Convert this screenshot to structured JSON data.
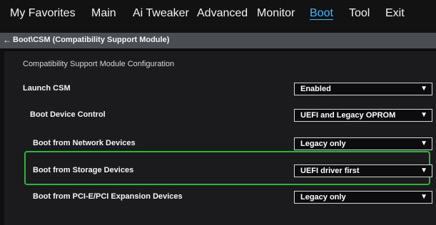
{
  "tabs": [
    {
      "label": "My Favorites"
    },
    {
      "label": "Main"
    },
    {
      "label": "Ai Tweaker"
    },
    {
      "label": "Advanced"
    },
    {
      "label": "Monitor"
    },
    {
      "label": "Boot",
      "active": true
    },
    {
      "label": "Tool"
    },
    {
      "label": "Exit"
    }
  ],
  "breadcrumb": {
    "text": "Boot\\CSM (Compatibility Support Module)"
  },
  "section": {
    "title": "Compatibility Support Module Configuration"
  },
  "settings": [
    {
      "label": "Launch CSM",
      "value": "Enabled"
    },
    {
      "label": "Boot Device Control",
      "value": "UEFI and Legacy OPROM"
    },
    {
      "label": "Boot from Network Devices",
      "value": "Legacy only"
    },
    {
      "label": "Boot from Storage Devices",
      "value": "UEFI driver first",
      "highlighted": true
    },
    {
      "label": "Boot from PCI-E/PCI Expansion Devices",
      "value": "Legacy only"
    }
  ],
  "colors": {
    "accent": "#3fb7ff",
    "highlight": "#2fb33a"
  },
  "icons": {
    "back": "back-arrow-icon",
    "dropdown": "chevron-down-icon"
  }
}
